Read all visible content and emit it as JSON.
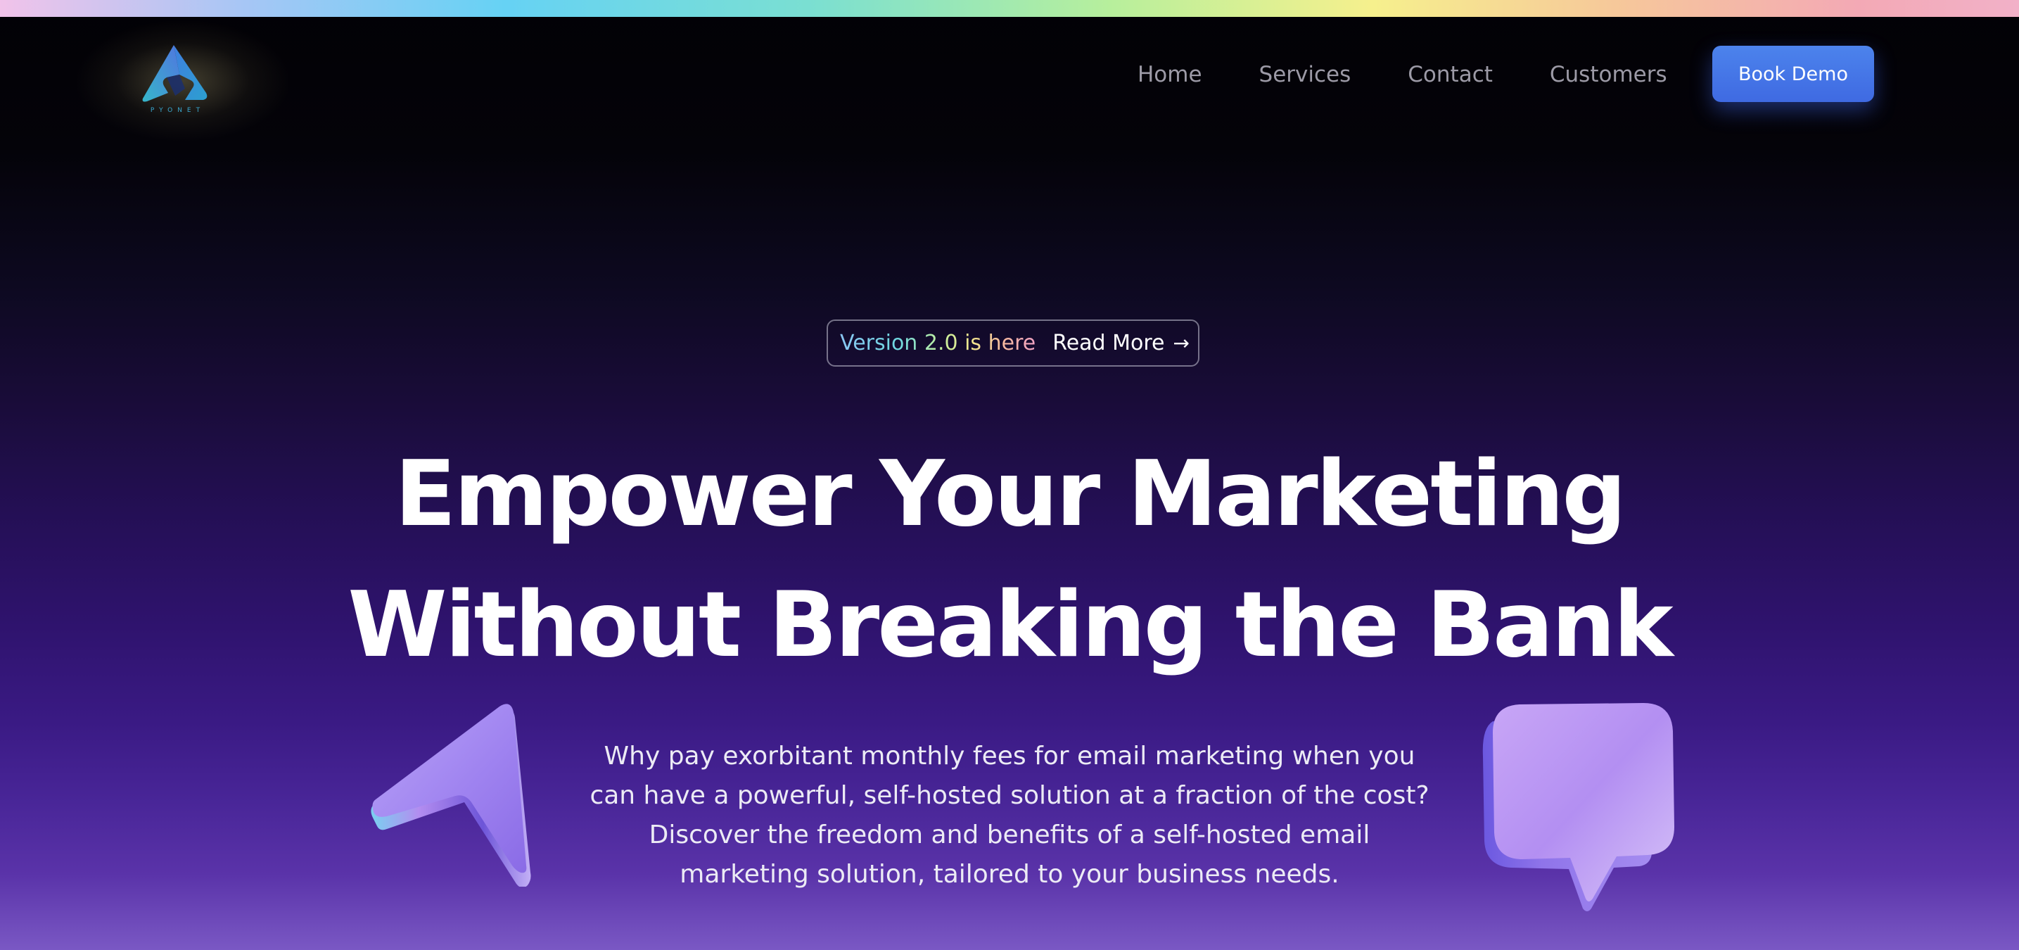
{
  "header": {
    "logo_text": "PYONET",
    "nav": [
      {
        "label": "Home"
      },
      {
        "label": "Services"
      },
      {
        "label": "Contact"
      },
      {
        "label": "Customers"
      }
    ],
    "cta_label": "Book Demo"
  },
  "hero": {
    "badge": {
      "version_text": "Version 2.0 is here",
      "link_label": "Read More",
      "link_icon": "arrow-right-icon"
    },
    "headline_line1": "Empower Your Marketing",
    "headline_line2": "Without Breaking the Bank",
    "description": "Why pay exorbitant monthly fees for email marketing when you can have a powerful, self-hosted solution at a fraction of the cost? Discover the freedom and benefits of a self-hosted email marketing solution, tailored to your business needs."
  },
  "decorations": {
    "left_icon": "paper-plane-icon",
    "right_icon": "chat-bubble-icon"
  },
  "colors": {
    "accent": "#4a7cea",
    "background_top": "#020105",
    "background_bottom": "#7a58c4",
    "nav_text": "#9c9aa6"
  }
}
